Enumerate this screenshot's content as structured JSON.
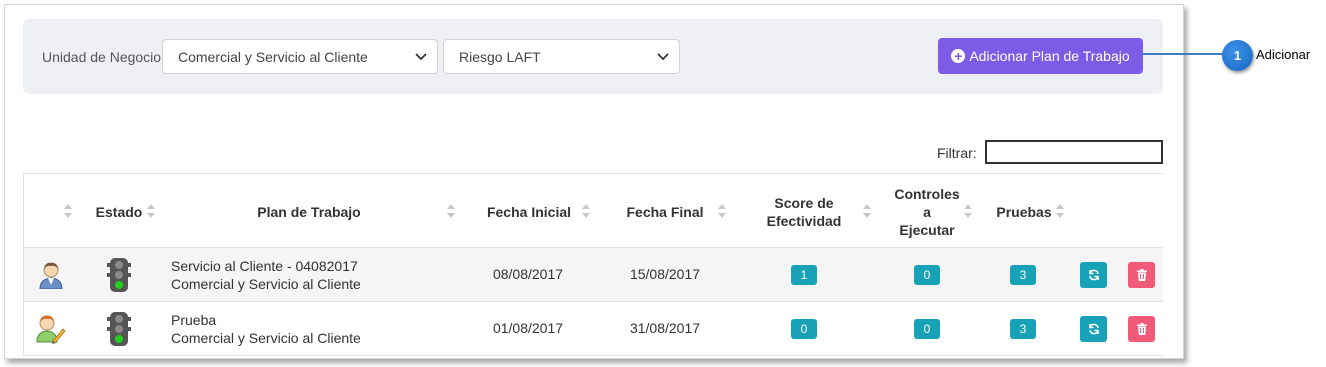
{
  "filter_bar": {
    "business_unit_label": "Unidad de Negocio",
    "business_unit_selected": "Comercial y Servicio al Cliente",
    "risk_selected": "Riesgo LAFT",
    "add_button_label": "Adicionar Plan de Trabajo"
  },
  "search": {
    "label": "Filtrar:",
    "value": ""
  },
  "table": {
    "columns": {
      "estado": "Estado",
      "plan": "Plan de Trabajo",
      "fecha_inicial": "Fecha Inicial",
      "fecha_final": "Fecha Final",
      "score_line1": "Score de",
      "score_line2": "Efectividad",
      "controles_line1": "Controles",
      "controles_line2": "a",
      "controles_line3": "Ejecutar",
      "pruebas": "Pruebas"
    },
    "rows": [
      {
        "user_icon": "user-icon",
        "status_icon": "traffic-light-green-icon",
        "plan_name": "Servicio al Cliente - 04082017",
        "business_unit": "Comercial y Servicio al Cliente",
        "fecha_inicial": "08/08/2017",
        "fecha_final": "15/08/2017",
        "score": "1",
        "controles": "0",
        "pruebas": "3"
      },
      {
        "user_icon": "user-edit-icon",
        "status_icon": "traffic-light-green-icon",
        "plan_name": "Prueba",
        "business_unit": "Comercial y Servicio al Cliente",
        "fecha_inicial": "01/08/2017",
        "fecha_final": "31/08/2017",
        "score": "0",
        "controles": "0",
        "pruebas": "3"
      }
    ]
  },
  "callout": {
    "number": "1",
    "label": "Adicionar"
  },
  "colors": {
    "primary_button": "#7c5ce6",
    "badge": "#17a2b8",
    "delete_button": "#f25a7a",
    "callout": "#1e6fd0"
  }
}
